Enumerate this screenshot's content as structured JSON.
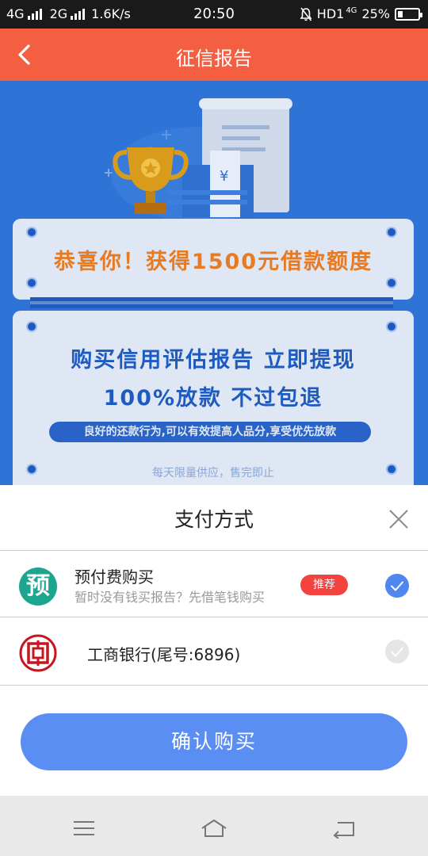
{
  "status_bar": {
    "net1": "4G",
    "net2": "2G",
    "speed": "1.6K/s",
    "time": "20:50",
    "hd": "HD1",
    "net3": "4G",
    "battery": "25%",
    "battery_level": 0.25
  },
  "header": {
    "title": "征信报告",
    "back_icon": "chevron-left-icon"
  },
  "promo": {
    "congrats": "恭喜你！获得1500元借款额度",
    "buy_line": "购买信用评估报告   立即提现",
    "guarantee": "100%放款 不过包退",
    "tagline": "良好的还款行为,可以有效提高人品分,享受优先放款",
    "limited": "每天限量供应，售完即止",
    "colors": {
      "background": "#2e73d6",
      "congrats": "#e67b24",
      "headline": "#1f5bbf"
    }
  },
  "payment": {
    "title": "支付方式",
    "options": [
      {
        "icon_char": "预",
        "label": "预付费购买",
        "sublabel": "暂时没有钱买报告？先借笔钱购买",
        "badge": "推荐",
        "selected": true
      },
      {
        "icon": "icbc-bank-icon",
        "label": "工商银行(尾号:6896)",
        "selected": false
      }
    ],
    "confirm_label": "确认购买",
    "colors": {
      "accent": "#5b8ef3",
      "badge": "#f2433f",
      "prepaid_icon": "#1da58f",
      "bank_icon": "#c7161e"
    }
  },
  "nav": {
    "menu_icon": "menu-icon",
    "home_icon": "home-icon",
    "back_icon": "back-icon"
  }
}
